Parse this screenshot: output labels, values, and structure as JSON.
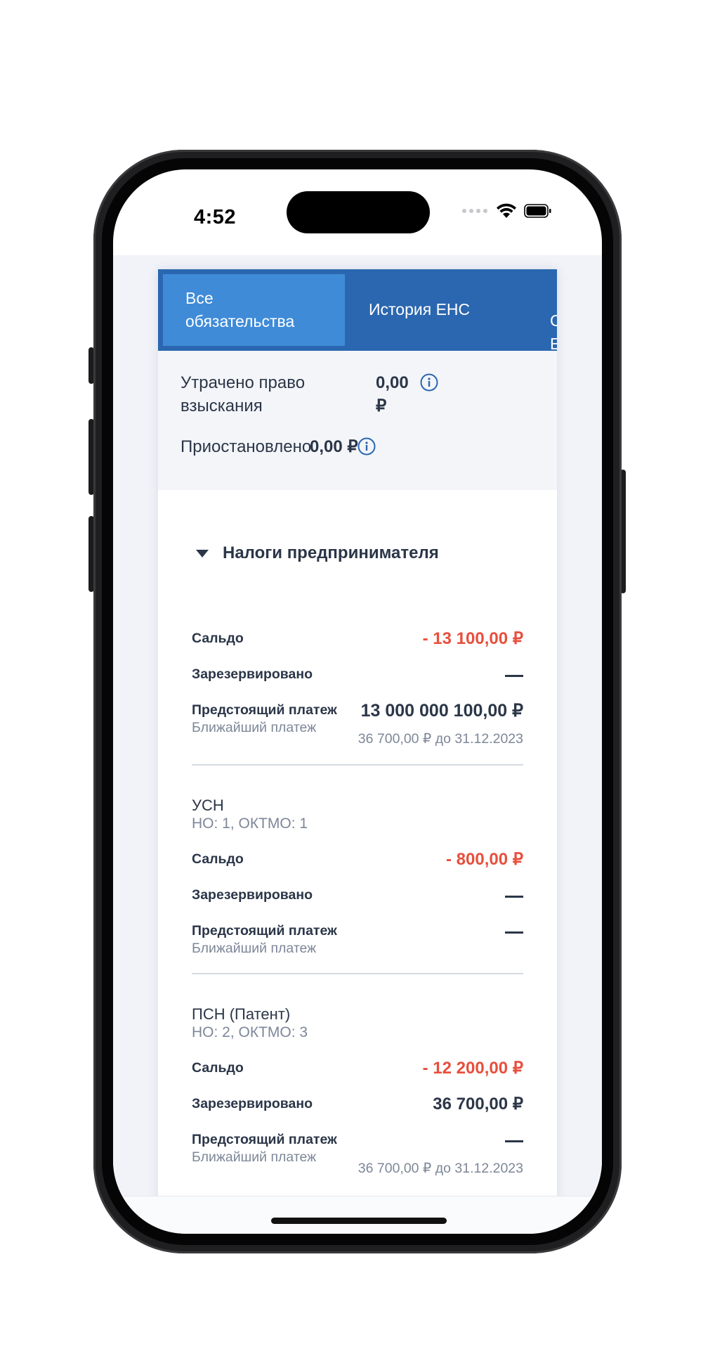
{
  "status_bar": {
    "time": "4:52"
  },
  "tabs": [
    {
      "label": "Все обязательства",
      "active": true
    },
    {
      "label": "История ЕНС",
      "active": false
    },
    {
      "label": "С\nЕ",
      "active": false
    }
  ],
  "summary": {
    "lost_label": "Утрачено право взыскания",
    "lost_value": "0,00 ₽",
    "suspended_label": "Приостановлено",
    "suspended_value": "0,00 ₽"
  },
  "group": {
    "title": "Налоги предпринимателя"
  },
  "total": {
    "saldo_label": "Сальдо",
    "saldo_value": "- 13 100,00 ₽",
    "reserved_label": "Зарезервировано",
    "upcoming_label": "Предстоящий платеж",
    "upcoming_value": "13 000 000 100,00 ₽",
    "nearest_label": "Ближайший платеж",
    "nearest_value": "36 700,00 ₽ до 31.12.2023"
  },
  "usn": {
    "title": "УСН",
    "subtitle": "НО: 1, ОКТМО: 1",
    "saldo_label": "Сальдо",
    "saldo_value": "- 800,00 ₽",
    "reserved_label": "Зарезервировано",
    "upcoming_label": "Предстоящий платеж",
    "nearest_label": "Ближайший платеж"
  },
  "psn": {
    "title": "ПСН (Патент)",
    "subtitle": "НО: 2, ОКТМО: 3",
    "saldo_label": "Сальдо",
    "saldo_value": "- 12 200,00 ₽",
    "reserved_label": "Зарезервировано",
    "reserved_value": "36 700,00 ₽",
    "upcoming_label": "Предстоящий платеж",
    "nearest_label": "Ближайший платеж",
    "nearest_value": "36 700,00 ₽ до 31.12.2023"
  },
  "colors": {
    "tab_bar": "#2b67b0",
    "tab_active": "#3f8bd8",
    "negative": "#e84f3d",
    "text": "#2b3648",
    "muted": "#7d8798"
  }
}
